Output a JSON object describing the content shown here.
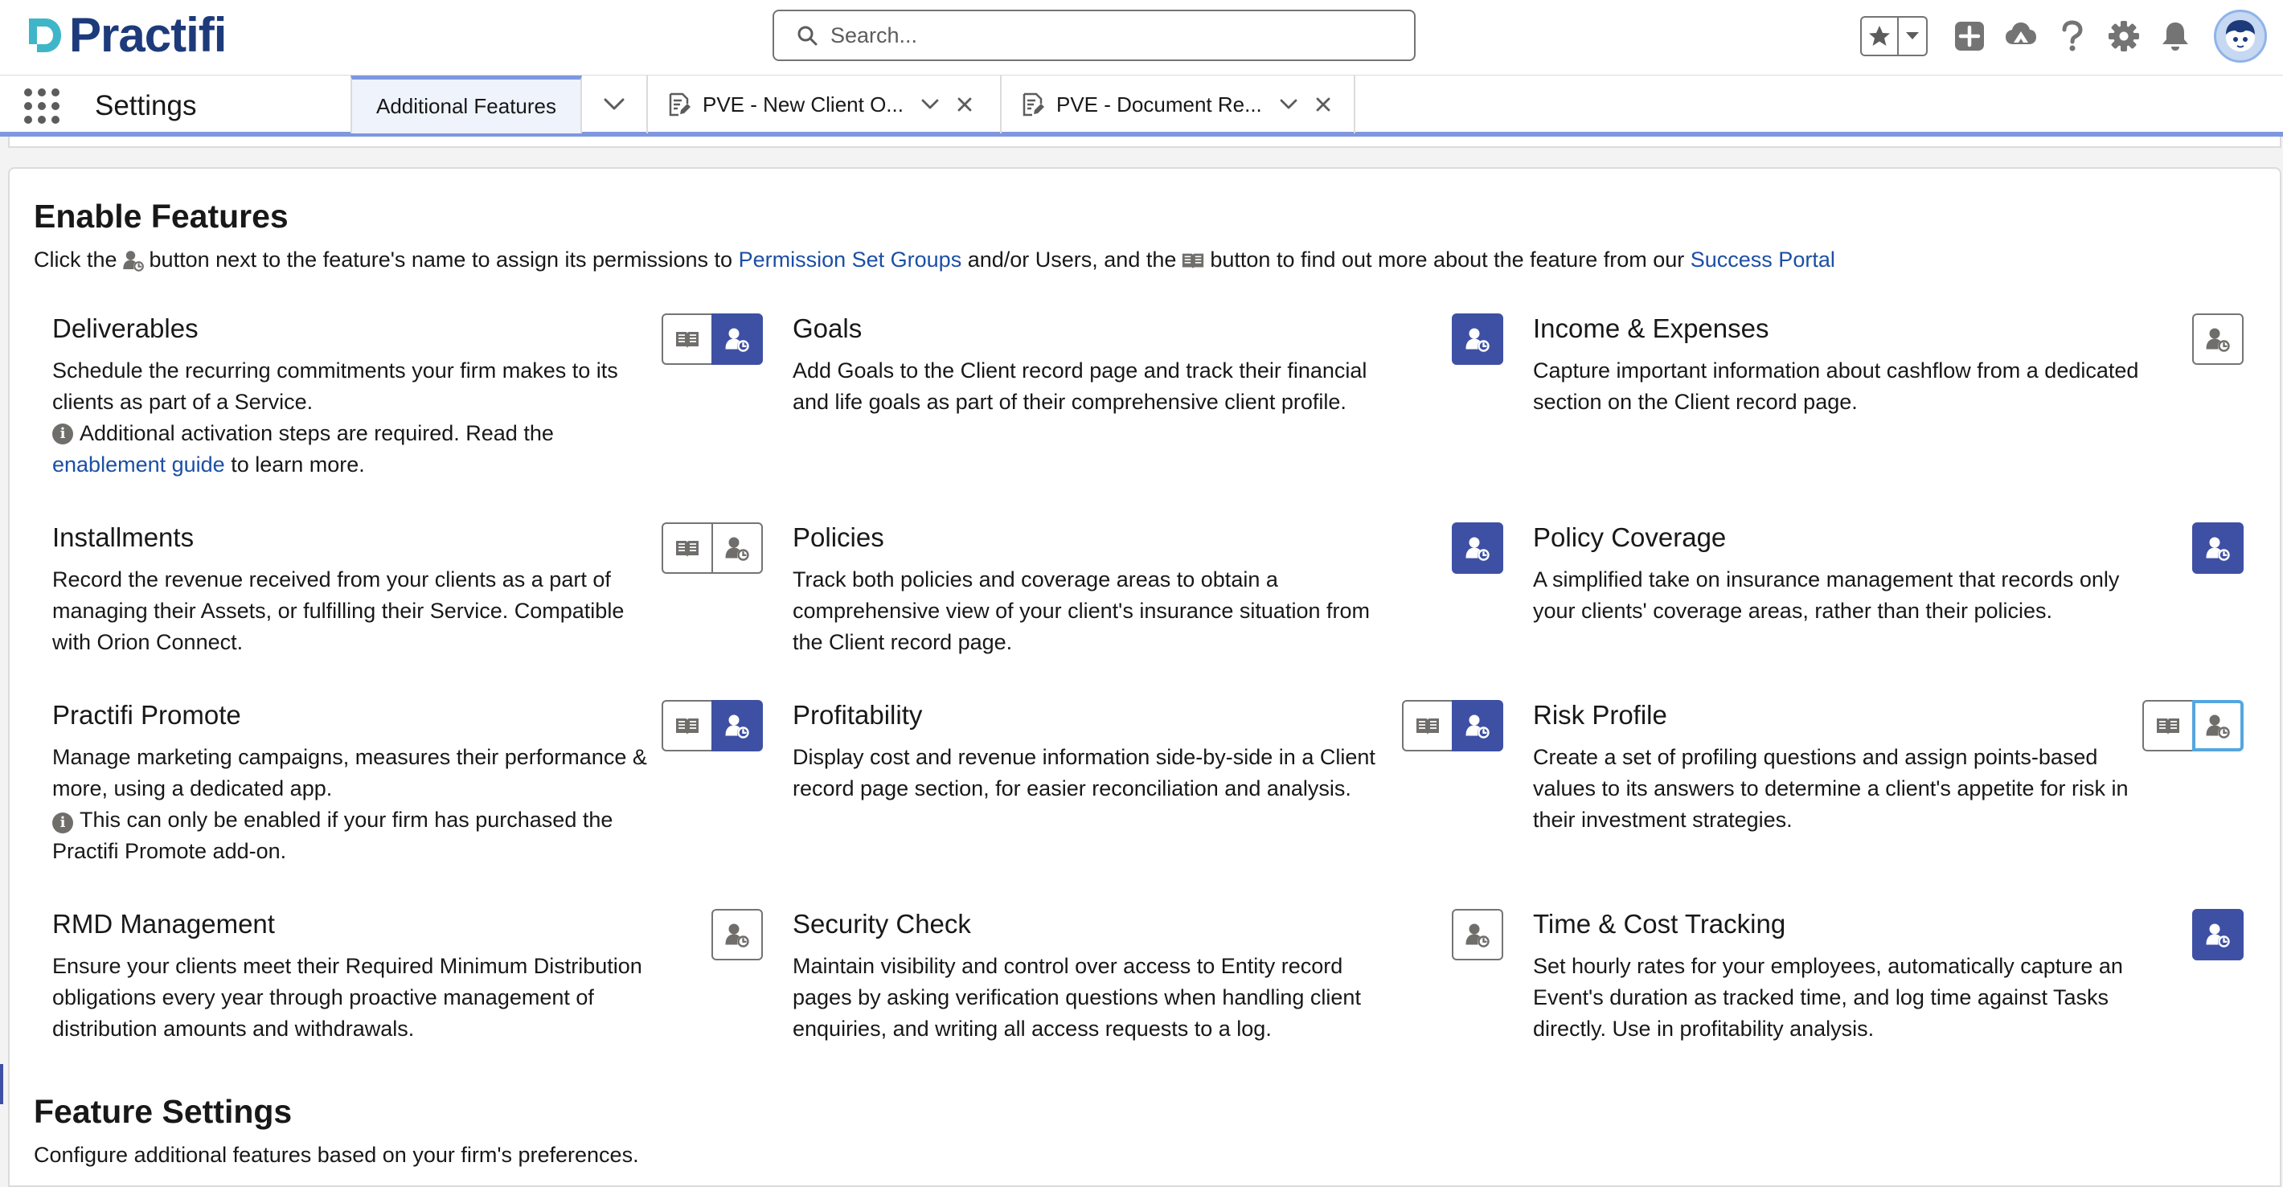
{
  "header": {
    "logo_text": "Practifi",
    "search_placeholder": "Search...",
    "icons": [
      "star-icon",
      "chevron-down-icon",
      "add-icon",
      "trailhead-icon",
      "help-icon",
      "gear-icon",
      "bell-icon",
      "avatar-icon"
    ]
  },
  "nav": {
    "app_name": "Settings",
    "tabs": [
      {
        "label": "Additional Features",
        "active": true
      },
      {
        "label": "PVE - New Client O...",
        "icon": "record-icon"
      },
      {
        "label": "PVE - Document Re...",
        "icon": "record-icon"
      }
    ]
  },
  "enable": {
    "title": "Enable Features",
    "desc_1": "Click the",
    "desc_2": "button next to the feature's name to assign its permissions to",
    "desc_link_1": "Permission Set Groups",
    "desc_3": "and/or Users, and the",
    "desc_4": "button to find out more about the feature from our",
    "desc_link_2": "Success Portal"
  },
  "features": [
    {
      "title": "Deliverables",
      "desc": "Schedule the recurring commitments your firm makes to its clients as part of a Service.",
      "note": "Additional activation steps are required. Read the",
      "note_link": "enablement guide",
      "note_tail": "to learn more.",
      "book": true,
      "enabled": true
    },
    {
      "title": "Goals",
      "desc": "Add Goals to the Client record page and track their financial and life goals as part of their comprehensive client profile.",
      "book": false,
      "enabled": true
    },
    {
      "title": "Income & Expenses",
      "desc": "Capture important information about cashflow from a dedicated section on the Client record page.",
      "book": false,
      "enabled": false
    },
    {
      "title": "Installments",
      "desc": "Record the revenue received from your clients as a part of managing their Assets, or fulfilling their Service. Compatible with Orion Connect.",
      "book": true,
      "enabled": false
    },
    {
      "title": "Policies",
      "desc": "Track both policies and coverage areas to obtain a comprehensive view of your client's insurance situation from the Client record page.",
      "book": false,
      "enabled": true
    },
    {
      "title": "Policy Coverage",
      "desc": "A simplified take on insurance management that records only your clients' coverage areas, rather than their policies.",
      "book": false,
      "enabled": true
    },
    {
      "title": "Practifi Promote",
      "desc": "Manage marketing campaigns, measures their performance & more, using a dedicated app.",
      "note": "This can only be enabled if your firm has purchased the Practifi Promote add-on.",
      "book": true,
      "enabled": true
    },
    {
      "title": "Profitability",
      "desc": "Display cost and revenue information side-by-side in a Client record page section, for easier reconciliation and analysis.",
      "book": true,
      "enabled": true
    },
    {
      "title": "Risk Profile",
      "desc": "Create a set of profiling questions and assign points-based values to its answers to determine a client's appetite for risk in their investment strategies.",
      "book": true,
      "enabled": false,
      "focused": true
    },
    {
      "title": "RMD Management",
      "desc": "Ensure your clients meet their Required Minimum Distribution obligations every year through proactive management of distribution amounts and withdrawals.",
      "book": false,
      "enabled": false
    },
    {
      "title": "Security Check",
      "desc": "Maintain visibility and control over access to Entity record pages by asking verification questions when handling client enquiries, and writing all access requests to a log.",
      "book": false,
      "enabled": false
    },
    {
      "title": "Time & Cost Tracking",
      "desc": "Set hourly rates for your employees, automatically capture an Event's duration as tracked time, and log time against Tasks directly. Use in profitability analysis.",
      "book": false,
      "enabled": true
    }
  ],
  "settings": {
    "title": "Feature Settings",
    "desc": "Configure additional features based on your firm's preferences."
  },
  "colors": {
    "brand": "#1d3a7a",
    "logo_teal": "#3fb6c8",
    "button_active": "#3e50a4",
    "link": "#1b4fa5",
    "focus_ring": "#55a6df"
  }
}
